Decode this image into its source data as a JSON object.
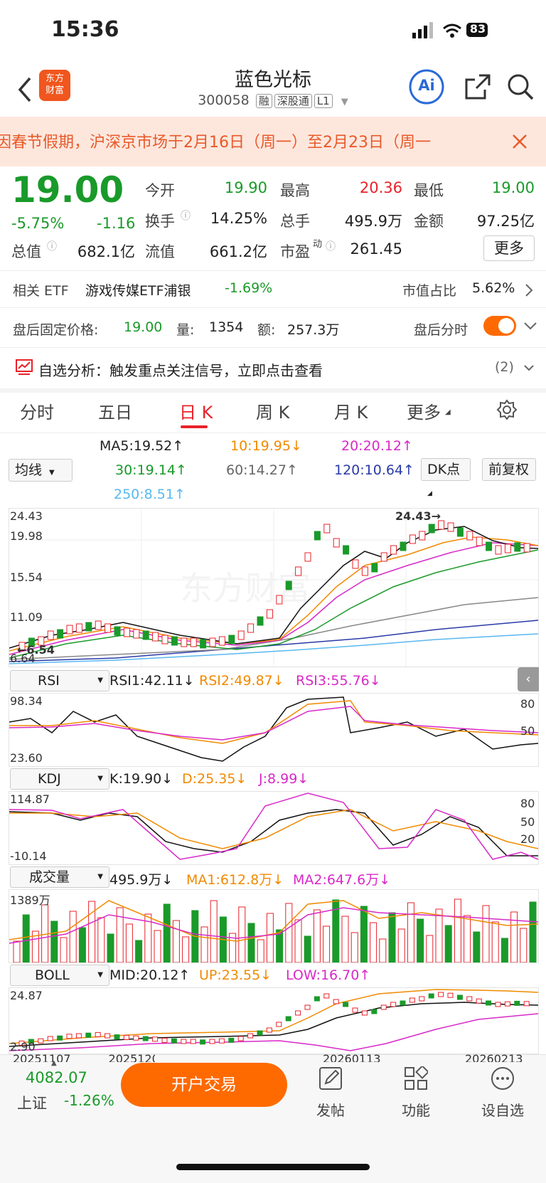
{
  "status": {
    "time": "15:36",
    "battery": "83"
  },
  "header": {
    "back_icon": "chevron-left-icon",
    "logo_text": "东方财富",
    "title": "蓝色光标",
    "code": "300058",
    "tags": [
      "融",
      "深股通",
      "L1"
    ],
    "ai_label": "Ai"
  },
  "banner": {
    "text": "因春节假期，沪深京市场于2月16日（周一）至2月23日（周一"
  },
  "quote": {
    "price": "19.00",
    "change_pct": "-5.75%",
    "change": "-1.16",
    "open_label": "今开",
    "open": "19.90",
    "high_label": "最高",
    "high": "20.36",
    "low_label": "最低",
    "low": "19.00",
    "turnover_label": "换手",
    "turnover": "14.25%",
    "volume_label": "总手",
    "volume": "495.9万",
    "amount_label": "金额",
    "amount": "97.25亿",
    "mktcap_label": "总值",
    "mktcap": "682.1亿",
    "float_label": "流值",
    "float_cap": "661.2亿",
    "pe_label": "市盈",
    "pe_sup": "动",
    "pe": "261.45",
    "more_button": "更多"
  },
  "etf": {
    "label": "相关 ETF",
    "name": "游戏传媒ETF浦银",
    "change": "-1.69%",
    "share_label": "市值占比",
    "share": "5.62%"
  },
  "afterhours": {
    "price_label": "盘后固定价格:",
    "price": "19.00",
    "vol_label": "量:",
    "vol": "1354",
    "amt_label": "额:",
    "amt": "257.3万",
    "toggle_label": "盘后分时"
  },
  "watch": {
    "label": "自选分析：触发重点关注信号，立即点击查看",
    "count": "(2)"
  },
  "tabs": [
    "分时",
    "五日",
    "日 K",
    "周 K",
    "月 K",
    "更多"
  ],
  "ma": {
    "selector": "均线",
    "ma5": "MA5:19.52↑",
    "ma10": "10:19.95↓",
    "ma20": "20:20.12↑",
    "ma30": "30:19.14↑",
    "ma60": "60:14.27↑",
    "ma120": "120:10.64↑",
    "ma250": "250:8.51↑",
    "dk_button": "DK点",
    "adjust_button": "前复权"
  },
  "kline": {
    "y_labels": [
      "24.43",
      "19.98",
      "15.54",
      "11.09",
      "6.64"
    ],
    "high_marker": "24.43→",
    "low_marker": "←6.54",
    "watermark": "东方财富",
    "nine_markers": [
      "1",
      "2",
      "3",
      "4",
      "5",
      "6",
      "7",
      "8",
      "9"
    ]
  },
  "rsi": {
    "selector": "RSI",
    "rsi1": "RSI1:42.11↓",
    "rsi2": "RSI2:49.87↓",
    "rsi3": "RSI3:55.76↓",
    "y_top": "98.34",
    "y_bottom": "23.60",
    "ref": [
      "80",
      "50"
    ]
  },
  "kdj": {
    "selector": "KDJ",
    "k": "K:19.90↓",
    "d": "D:25.35↓",
    "j": "J:8.99↓",
    "y_top": "114.87",
    "y_bottom": "-10.14",
    "ref": [
      "80",
      "50",
      "20"
    ]
  },
  "vol": {
    "selector": "成交量",
    "value": "495.9万↓",
    "ma1": "MA1:612.8万↓",
    "ma2": "MA2:647.6万↓",
    "y_top": "1389万"
  },
  "boll": {
    "selector": "BOLL",
    "mid": "MID:20.12↑",
    "up": "UP:23.55↓",
    "low": "LOW:16.70↑",
    "y_top": "24.87",
    "y_bottom": "2.90"
  },
  "dates": [
    "20251107",
    "20251209",
    "20260113",
    "20260213"
  ],
  "bottom": {
    "index_value": "4082.07",
    "index_name": "上证",
    "index_change": "-1.26%",
    "trade_button": "开户交易",
    "post": "发帖",
    "function": "功能",
    "watchlist": "设自选"
  },
  "colors": {
    "red": "#e8222a",
    "green": "#1a9a2a",
    "orange": "#f08a00",
    "magenta": "#d829c8",
    "accent": "#ff6a00"
  }
}
